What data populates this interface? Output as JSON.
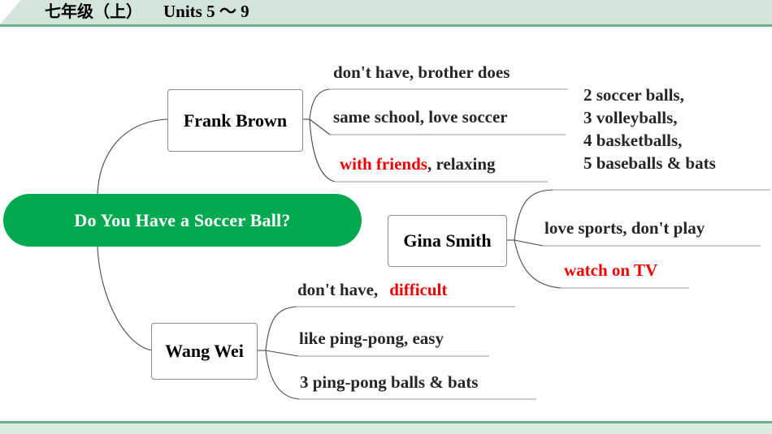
{
  "header": {
    "grade": "七年级",
    "volume": "（上）",
    "units": "Units 5 ～ 9"
  },
  "mindmap": {
    "central": {
      "label": "Do You Have a Soccer Ball?",
      "color": "#00a94f",
      "text_color": "#ffffff"
    },
    "accent_red": "#ee0000",
    "branches": [
      {
        "name": "Frank Brown",
        "leaves": [
          {
            "parts": [
              {
                "text": "don't have, brother does",
                "color": "black"
              }
            ]
          },
          {
            "parts": [
              {
                "text": "same school, love soccer",
                "color": "black"
              }
            ]
          },
          {
            "parts": [
              {
                "text": "with friends",
                "color": "red"
              },
              {
                "text": ", relaxing",
                "color": "black"
              }
            ]
          }
        ]
      },
      {
        "name": "Gina Smith",
        "leaves": [
          {
            "parts": [
              {
                "text": "2 soccer balls,\n3 volleyballs,\n4 basketballs,\n5 baseballs & bats",
                "color": "black"
              }
            ]
          },
          {
            "parts": [
              {
                "text": "love sports, don't play",
                "color": "black"
              }
            ]
          },
          {
            "parts": [
              {
                "text": "watch on TV",
                "color": "red"
              }
            ]
          }
        ]
      },
      {
        "name": "Wang Wei",
        "leaves": [
          {
            "parts": [
              {
                "text": "don't have,",
                "color": "black"
              },
              {
                "text": "  difficult",
                "color": "red"
              }
            ]
          },
          {
            "parts": [
              {
                "text": "like ping-pong, easy",
                "color": "black"
              }
            ]
          },
          {
            "parts": [
              {
                "text": "3 ping-pong balls & bats",
                "color": "black"
              }
            ]
          }
        ]
      }
    ]
  },
  "leaf_text": {
    "frank_1": "don't have, brother does",
    "frank_2": "same school, love soccer",
    "frank_3_red": "with friends",
    "frank_3_rest": ", relaxing",
    "gina_1_l1": "2 soccer balls,",
    "gina_1_l2": "3 volleyballs,",
    "gina_1_l3": "4 basketballs,",
    "gina_1_l4": "5 baseballs & bats",
    "gina_2": "love sports, don't play",
    "gina_3_red": "watch on TV",
    "wang_1": "don't have,",
    "wang_1_red": "difficult",
    "wang_2": "like ping-pong, easy",
    "wang_3": "3 ping-pong balls & bats"
  },
  "node_labels": {
    "frank": "Frank Brown",
    "gina": "Gina Smith",
    "wang": "Wang Wei",
    "central": "Do You Have a Soccer Ball?"
  }
}
